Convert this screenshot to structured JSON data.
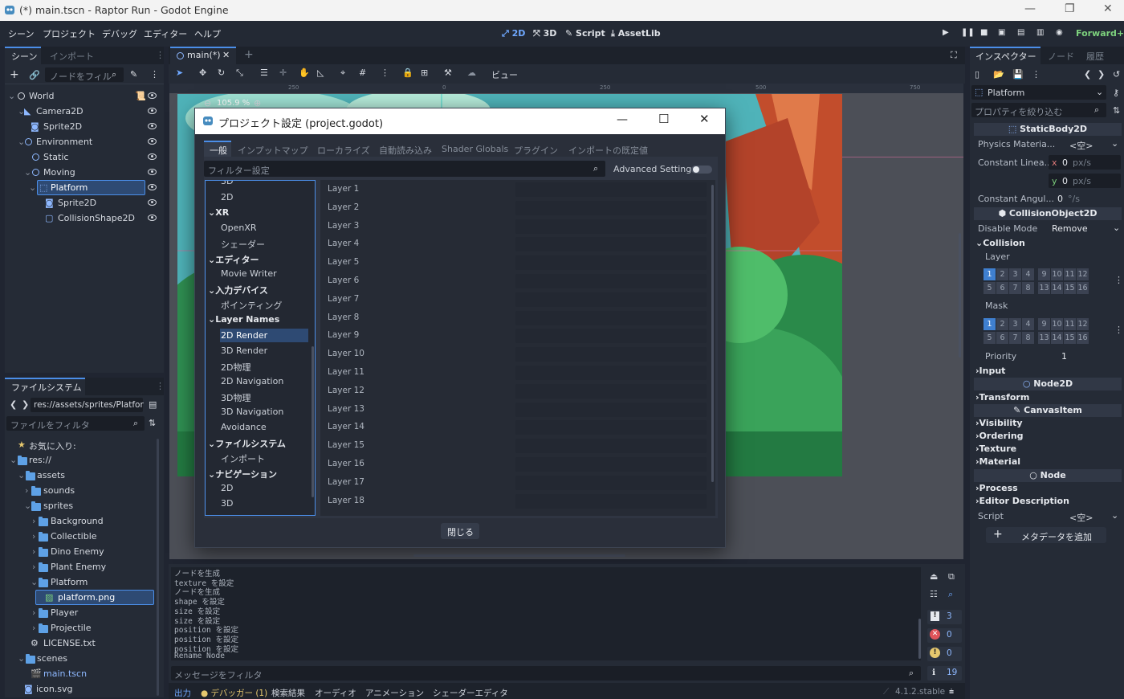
{
  "window": {
    "title": "(*) main.tscn - Raptor Run - Godot Engine"
  },
  "menu": [
    "シーン",
    "プロジェクト",
    "デバッグ",
    "エディター",
    "ヘルプ"
  ],
  "workspaces": {
    "w2d": "2D",
    "w3d": "3D",
    "script": "Script",
    "assetlib": "AssetLib"
  },
  "renderer": "Forward+",
  "scene_dock": {
    "tabs": [
      "シーン",
      "インポート"
    ],
    "filter_placeholder": "ノードをフィル",
    "nodes": [
      {
        "label": "World"
      },
      {
        "label": "Camera2D"
      },
      {
        "label": "Sprite2D"
      },
      {
        "label": "Environment"
      },
      {
        "label": "Static"
      },
      {
        "label": "Moving"
      },
      {
        "label": "Platform"
      },
      {
        "label": "Sprite2D"
      },
      {
        "label": "CollisionShape2D"
      }
    ]
  },
  "filesystem": {
    "tab": "ファイルシステム",
    "path": "res://assets/sprites/Platfor",
    "filter_placeholder": "ファイルをフィルタ",
    "items": [
      {
        "label": "お気に入り:"
      },
      {
        "label": "res://"
      },
      {
        "label": "assets"
      },
      {
        "label": "sounds"
      },
      {
        "label": "sprites"
      },
      {
        "label": "Background"
      },
      {
        "label": "Collectible"
      },
      {
        "label": "Dino Enemy"
      },
      {
        "label": "Plant Enemy"
      },
      {
        "label": "Platform"
      },
      {
        "label": "platform.png"
      },
      {
        "label": "Player"
      },
      {
        "label": "Projectile"
      },
      {
        "label": "LICENSE.txt"
      },
      {
        "label": "scenes"
      },
      {
        "label": "main.tscn"
      },
      {
        "label": "icon.svg"
      }
    ]
  },
  "editor": {
    "tab": "main(*)",
    "view_menu": "ビュー",
    "zoom": "105.9 %",
    "ruler": [
      "250",
      "0",
      "250",
      "500",
      "750"
    ]
  },
  "dialog": {
    "title": "プロジェクト設定 (project.godot)",
    "tabs": [
      "一般",
      "インプットマップ",
      "ローカライズ",
      "自動読み込み",
      "Shader Globals",
      "プラグイン",
      "インポートの既定値"
    ],
    "filter_placeholder": "フィルター設定",
    "advanced_label": "Advanced Settings",
    "advanced_on": false,
    "categories": [
      {
        "label": "3D"
      },
      {
        "label": "2D"
      },
      {
        "label": "XR"
      },
      {
        "label": "OpenXR"
      },
      {
        "label": "シェーダー"
      },
      {
        "label": "エディター"
      },
      {
        "label": "Movie Writer"
      },
      {
        "label": "入力デバイス"
      },
      {
        "label": "ポインティング"
      },
      {
        "label": "Layer Names"
      },
      {
        "label": "2D Render"
      },
      {
        "label": "3D Render"
      },
      {
        "label": "2D物理"
      },
      {
        "label": "2D Navigation"
      },
      {
        "label": "3D物理"
      },
      {
        "label": "3D Navigation"
      },
      {
        "label": "Avoidance"
      },
      {
        "label": "ファイルシステム"
      },
      {
        "label": "インポート"
      },
      {
        "label": "ナビゲーション"
      },
      {
        "label": "2D"
      },
      {
        "label": "3D"
      }
    ],
    "layers": [
      "Layer 1",
      "Layer 2",
      "Layer 3",
      "Layer 4",
      "Layer 5",
      "Layer 6",
      "Layer 7",
      "Layer 8",
      "Layer 9",
      "Layer 10",
      "Layer 11",
      "Layer 12",
      "Layer 13",
      "Layer 14",
      "Layer 15",
      "Layer 16",
      "Layer 17",
      "Layer 18"
    ],
    "close_label": "閉じる"
  },
  "inspector": {
    "tabs": [
      "インスペクター",
      "ノード",
      "履歴"
    ],
    "node_name": "Platform",
    "filter_placeholder": "プロパティを絞り込む",
    "static_body": "StaticBody2D",
    "physics_material": {
      "label": "Physics Materia...",
      "value": "<空>"
    },
    "constant_linear": {
      "label": "Constant Linea...",
      "x": "0",
      "y": "0",
      "unit": "px/s",
      "x_axis": "x",
      "y_axis": "y"
    },
    "constant_angular": {
      "label": "Constant Angul...",
      "value": "0",
      "unit": "°/s"
    },
    "collision_object": "CollisionObject2D",
    "disable_mode": {
      "label": "Disable Mode",
      "value": "Remove"
    },
    "collision_section": "Collision",
    "layer_label": "Layer",
    "mask_label": "Mask",
    "bits_top": [
      "1",
      "2",
      "3",
      "4",
      "9",
      "10",
      "11",
      "12"
    ],
    "bits_bottom": [
      "5",
      "6",
      "7",
      "8",
      "13",
      "14",
      "15",
      "16"
    ],
    "layer_on": [
      "1"
    ],
    "mask_on": [
      "1"
    ],
    "priority": {
      "label": "Priority",
      "value": "1"
    },
    "input": "Input",
    "node2d": "Node2D",
    "transform": "Transform",
    "canvas_item": "CanvasItem",
    "canvas_sections": [
      "Visibility",
      "Ordering",
      "Texture",
      "Material"
    ],
    "node": "Node",
    "node_sections": [
      "Process",
      "Editor Description"
    ],
    "script": {
      "label": "Script",
      "value": "<空>"
    },
    "add_metadata": "メタデータを追加"
  },
  "output": {
    "lines": [
      "ノードを生成",
      "texture を設定",
      "ノードを生成",
      "shape を設定",
      "size を設定",
      "size を設定",
      "position を設定",
      "position を設定",
      "position を設定",
      "Rename Node"
    ],
    "filter_placeholder": "メッセージをフィルタ",
    "counts": {
      "warnings_all": "3",
      "errors": "0",
      "warnings": "0",
      "info": "19"
    }
  },
  "bottom_tabs": [
    "出力",
    "デバッガー (1)",
    "検索結果",
    "オーディオ",
    "アニメーション",
    "シェーダーエディタ"
  ],
  "version": "4.1.2.stable",
  "colors": {
    "accent": "#4b8ee8",
    "panel": "#252b36",
    "bg": "#1d222b",
    "selected": "#2e4a73"
  }
}
